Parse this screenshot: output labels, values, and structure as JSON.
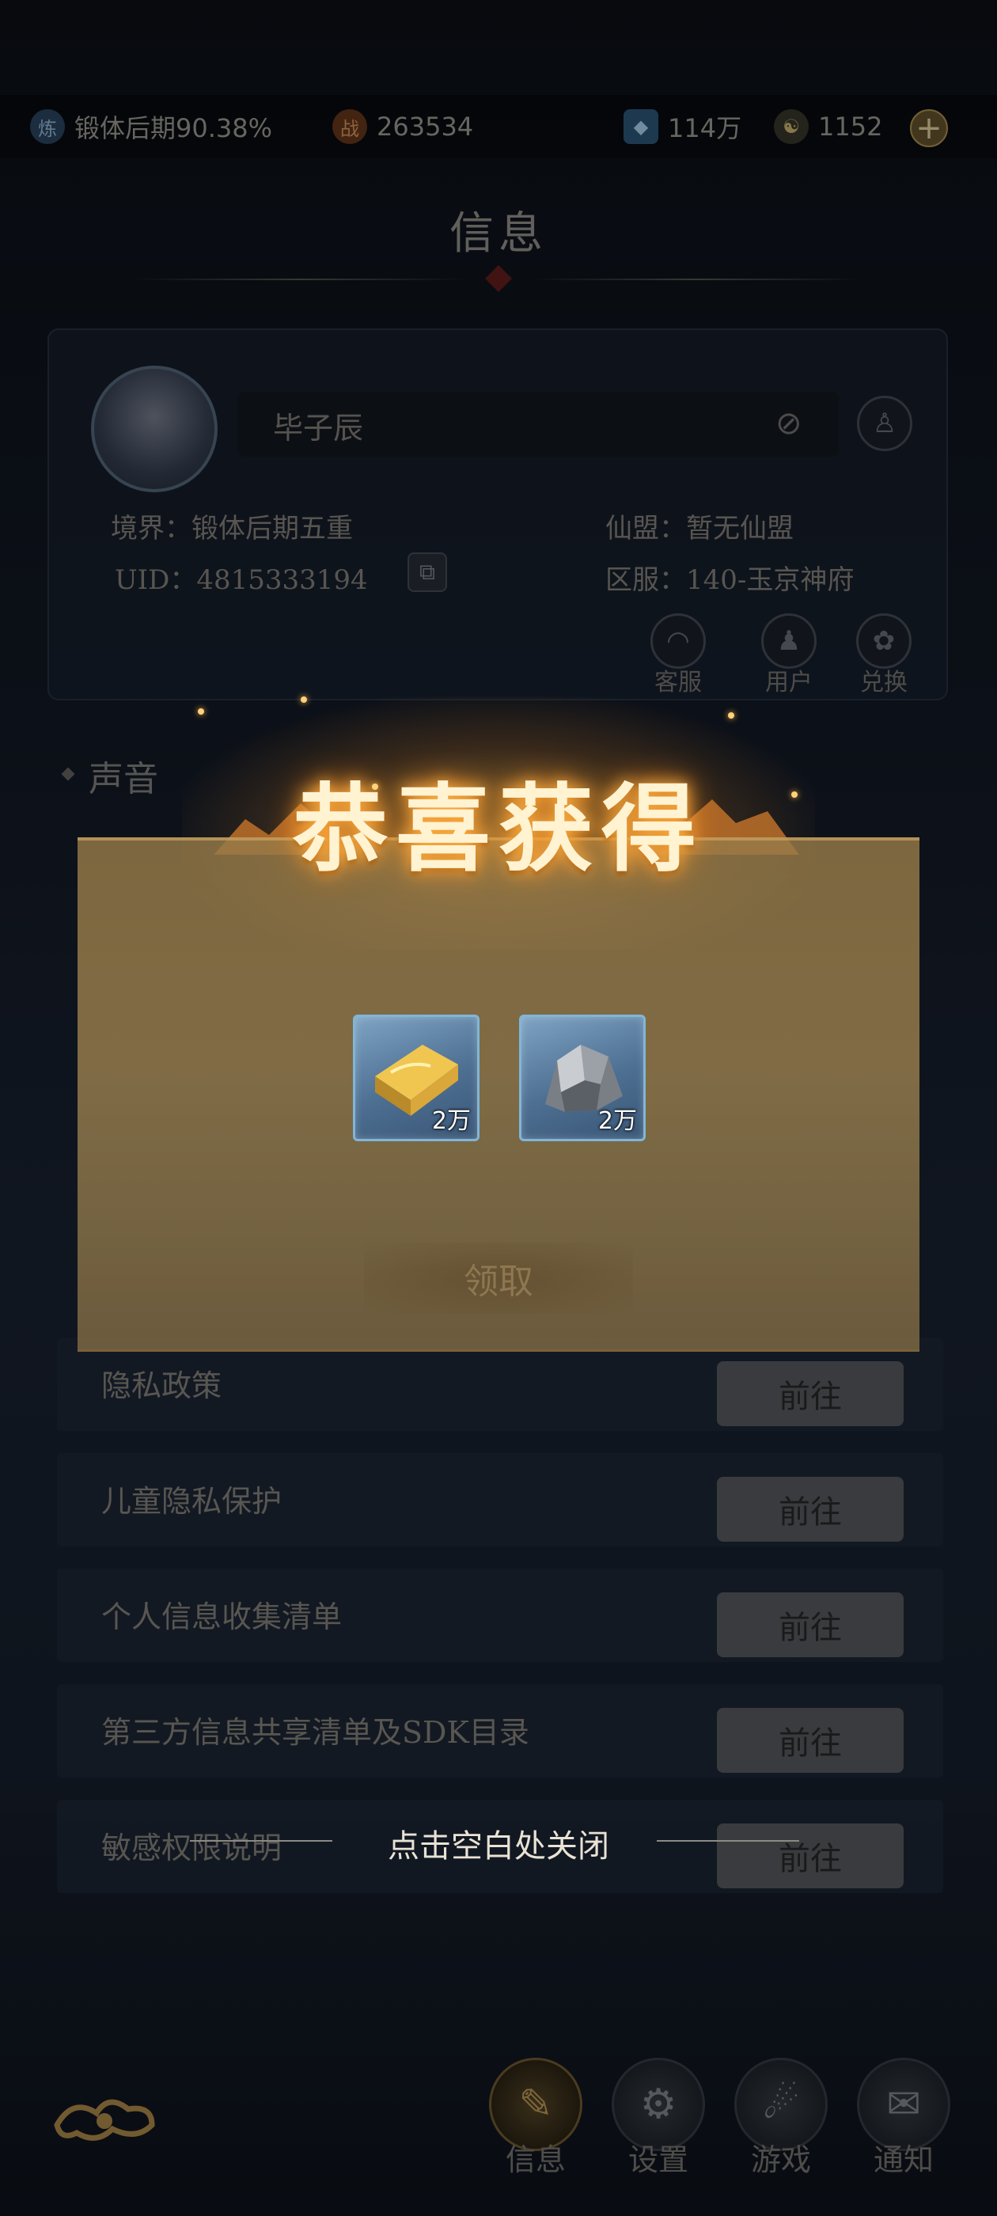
{
  "status_bar": {
    "realm_progress": "锻体后期90.38%",
    "power": "263534",
    "spirit_stones": "114万",
    "gold": "1152"
  },
  "page": {
    "title": "信息"
  },
  "profile": {
    "name": "毕子辰",
    "realm_label": "境界：",
    "realm_value": "锻体后期五重",
    "uid_label": "UID：",
    "uid_value": "4815333194",
    "alliance_label": "仙盟：",
    "alliance_value": "暂无仙盟",
    "server_label": "区服：",
    "server_value": "140-玉京神府",
    "actions": [
      {
        "label": "客服",
        "icon": "headset-icon"
      },
      {
        "label": "用户",
        "icon": "user-icon"
      },
      {
        "label": "兑换",
        "icon": "gift-icon"
      }
    ]
  },
  "sound_section": {
    "label": "声音"
  },
  "policy_rows": [
    {
      "label": "隐私政策",
      "button": "前往"
    },
    {
      "label": "儿童隐私保护",
      "button": "前往"
    },
    {
      "label": "个人信息收集清单",
      "button": "前往"
    },
    {
      "label": "第三方信息共享清单及SDK目录",
      "button": "前往"
    },
    {
      "label": "敏感权限说明",
      "button": "前往"
    }
  ],
  "reward_popup": {
    "title": "恭喜获得",
    "items": [
      {
        "icon": "gold-bar-icon",
        "quantity": "2万"
      },
      {
        "icon": "iron-ore-icon",
        "quantity": "2万"
      }
    ],
    "claim_button": "领取",
    "close_hint": "点击空白处关闭"
  },
  "bottom_nav": [
    {
      "label": "信息",
      "icon": "info-scroll-icon",
      "active": true
    },
    {
      "label": "设置",
      "icon": "gear-icon",
      "active": false
    },
    {
      "label": "游戏",
      "icon": "game-icon",
      "active": false
    },
    {
      "label": "通知",
      "icon": "notice-icon",
      "active": false
    }
  ],
  "colors": {
    "background": "#131a26",
    "reward_title_glow": "#ffb347",
    "item_card_border": "#7fb6d9",
    "scroll_paper": "#9f8450"
  }
}
